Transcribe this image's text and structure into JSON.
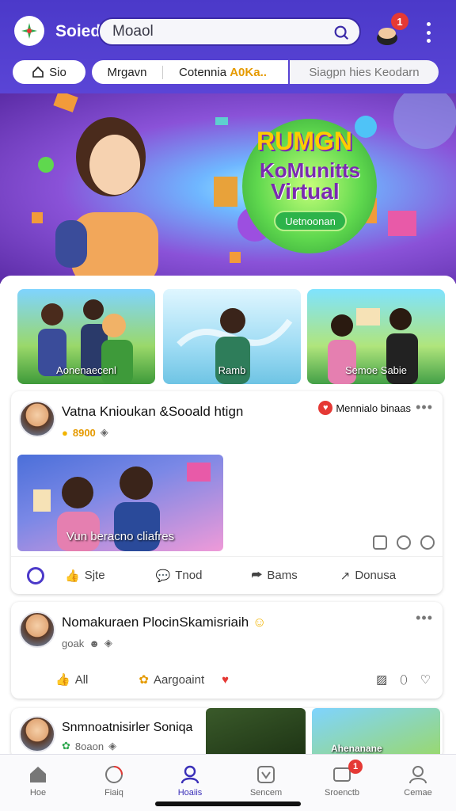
{
  "header": {
    "brand": "Soiedl",
    "search_value": "Moaol",
    "cart_count": "1",
    "accent": "#4b39c9"
  },
  "tabs": [
    {
      "label": "Sio"
    },
    {
      "label": "Mrgavn"
    },
    {
      "label": "Cotennia",
      "highlight": "A0Ka.."
    },
    {
      "label": "Siagpn hies Keodarn"
    }
  ],
  "hero": {
    "title1": "RUMGN",
    "title2": "KoMunitts",
    "title3": "Virtual",
    "button": "Uetnoonan"
  },
  "thumbs": [
    {
      "caption": "Aonenaecenl"
    },
    {
      "caption": "Ramb"
    },
    {
      "caption": "Semoe Sabie"
    }
  ],
  "post1": {
    "name": "Vatna Knioukan &Sooald htign",
    "stat": "8900",
    "tag": "Mennialo binaas",
    "image_caption": "Vun beracno cliafres",
    "actions": [
      "Sjte",
      "Tnod",
      "Bams",
      "Donusa"
    ]
  },
  "post2": {
    "name": "Nomakuraen PlocinSkamisriaih",
    "stat": "goak",
    "actions": [
      "All",
      "Aargoaint"
    ]
  },
  "post3": {
    "name": "Snmnoatnisirler Soniqa",
    "stat": "8oaon",
    "image_caption": "Ahenanane"
  },
  "nav": [
    {
      "label": "Hoe"
    },
    {
      "label": "Fiaiq"
    },
    {
      "label": "Hoaiis"
    },
    {
      "label": "Sencem"
    },
    {
      "label": "Sroenctb",
      "badge": "1"
    },
    {
      "label": "Cemae"
    }
  ]
}
